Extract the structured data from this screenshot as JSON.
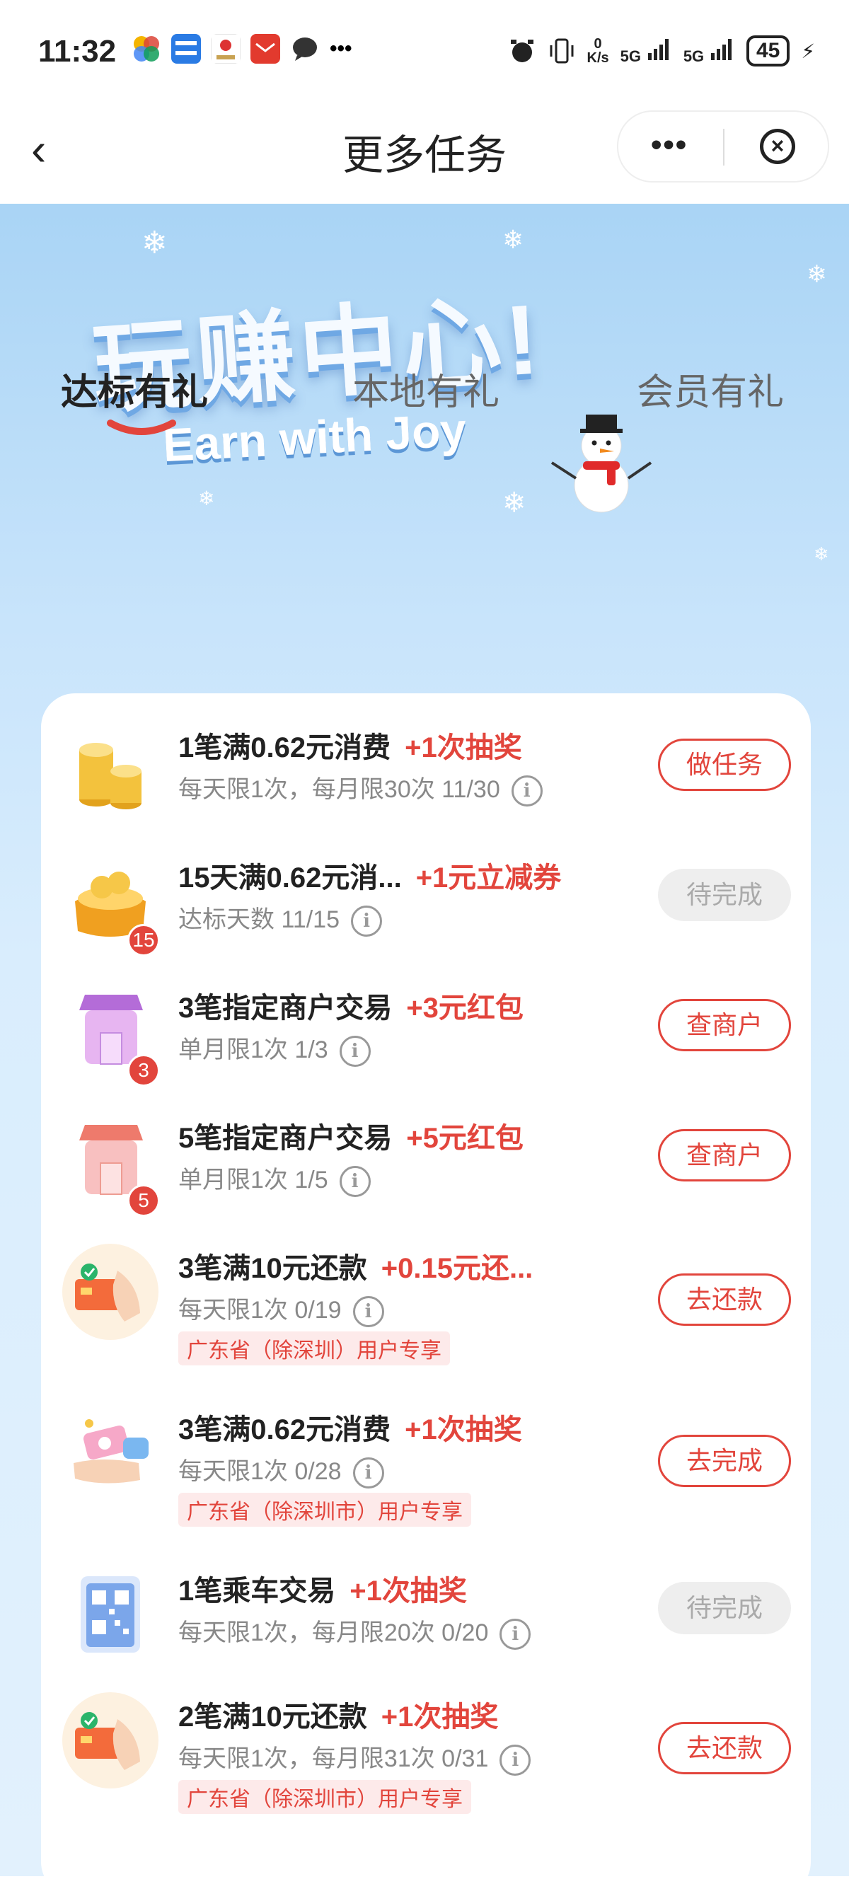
{
  "status": {
    "time": "11:32",
    "net_speed_top": "0",
    "net_speed_unit": "K/s",
    "signal_1": "5G",
    "signal_2": "5G",
    "battery": "45"
  },
  "nav": {
    "title": "更多任务",
    "more": "•••"
  },
  "hero": {
    "title": "玩赚中心!",
    "subtitle": "Earn with Joy"
  },
  "tabs": [
    {
      "label": "达标有礼",
      "active": true
    },
    {
      "label": "本地有礼",
      "active": false
    },
    {
      "label": "会员有礼",
      "active": false
    }
  ],
  "tasks": [
    {
      "title": "1笔满0.62元消费",
      "reward": "+1次抽奖",
      "subtitle": "每天限1次，每月限30次 11/30",
      "button": "做任务",
      "button_style": "red",
      "icon": "gold-coins-icon"
    },
    {
      "title": "15天满0.62元消...",
      "reward": "+1元立减券",
      "subtitle": "达标天数 11/15",
      "button": "待完成",
      "button_style": "grey",
      "icon": "treasure-chest-icon",
      "badge": "15"
    },
    {
      "title": "3笔指定商户交易",
      "reward": "+3元红包",
      "subtitle": "单月限1次 1/3",
      "button": "查商户",
      "button_style": "red",
      "icon": "shop-purple-icon",
      "badge": "3"
    },
    {
      "title": "5笔指定商户交易",
      "reward": "+5元红包",
      "subtitle": "单月限1次 1/5",
      "button": "查商户",
      "button_style": "red",
      "icon": "shop-pink-icon",
      "badge": "5"
    },
    {
      "title": "3笔满10元还款",
      "reward": "+0.15元还...",
      "subtitle": "每天限1次 0/19",
      "tag": "广东省（除深圳）用户专享",
      "button": "去还款",
      "button_style": "red",
      "icon": "card-hand-icon"
    },
    {
      "title": "3笔满0.62元消费",
      "reward": "+1次抽奖",
      "subtitle": "每天限1次 0/28",
      "tag": "广东省（除深圳市）用户专享",
      "button": "去完成",
      "button_style": "red",
      "icon": "cash-hand-icon"
    },
    {
      "title": "1笔乘车交易",
      "reward": "+1次抽奖",
      "subtitle": "每天限1次，每月限20次 0/20",
      "button": "待完成",
      "button_style": "grey",
      "icon": "qr-code-icon"
    },
    {
      "title": "2笔满10元还款",
      "reward": "+1次抽奖",
      "subtitle": "每天限1次，每月限31次 0/31",
      "tag": "广东省（除深圳市）用户专享",
      "button": "去还款",
      "button_style": "red",
      "icon": "card-hand-icon"
    }
  ],
  "colors": {
    "accent": "#e2453c",
    "hero_top": "#a9d4f5",
    "hero_bottom": "#e2f1fd"
  }
}
